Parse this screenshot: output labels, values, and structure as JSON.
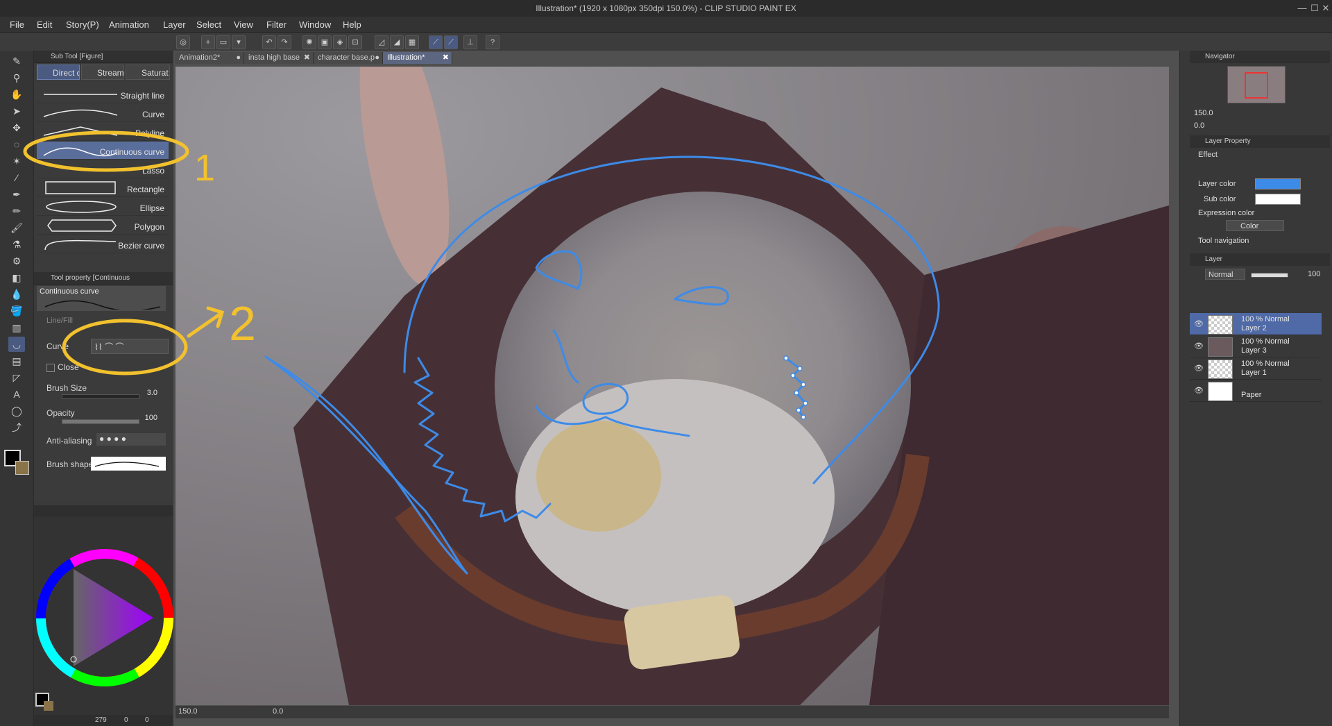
{
  "window": {
    "title": "Illustration* (1920 x 1080px 350dpi 150.0%)  - CLIP STUDIO PAINT EX",
    "minimize": "—",
    "maximize": "☐",
    "close": "✕"
  },
  "menu": [
    "File",
    "Edit",
    "Story(P)",
    "Animation",
    "Layer",
    "Select",
    "View",
    "Filter",
    "Window",
    "Help"
  ],
  "subtool_panel": {
    "header": "Sub Tool [Figure]",
    "tabs": [
      "Direct d",
      "Stream",
      "Saturat"
    ],
    "items": [
      {
        "label": "Straight line"
      },
      {
        "label": "Curve"
      },
      {
        "label": "Polyline"
      },
      {
        "label": "Continuous curve",
        "selected": true
      },
      {
        "label": "Lasso"
      },
      {
        "label": "Rectangle"
      },
      {
        "label": "Ellipse"
      },
      {
        "label": "Polygon"
      },
      {
        "label": "Bezier curve"
      }
    ]
  },
  "tool_property": {
    "header": "Tool property [Continuous",
    "preview_label": "Continuous curve",
    "line_fill": "Line/Fill",
    "curve_label": "Curve",
    "close_label": "Close",
    "brush_size_label": "Brush Size",
    "brush_size_value": "3.0",
    "opacity_label": "Opacity",
    "opacity_value": "100",
    "antialias_label": "Anti-aliasing",
    "brush_shape_label": "Brush shape"
  },
  "document_tabs": [
    {
      "label": "Animation2*",
      "close": "●"
    },
    {
      "label": "insta high base",
      "close": "✖"
    },
    {
      "label": "character base.p",
      "close": "●"
    },
    {
      "label": "Illustration*",
      "close": "✖",
      "active": true
    }
  ],
  "canvas_status": {
    "zoom": "150.0",
    "angle": "0.0"
  },
  "annotations": {
    "marker_1": "1",
    "marker_2": "2"
  },
  "navigator": {
    "header": "Navigator",
    "zoom": "150.0",
    "angle": "0.0"
  },
  "layer_property": {
    "header": "Layer Property",
    "effect": "Effect",
    "layer_color_label": "Layer color",
    "sub_color_label": "Sub color",
    "expression_color_label": "Expression color",
    "expression_color_value": "Color",
    "tool_navigation": "Tool navigation",
    "layer_color": "#3d8be8",
    "sub_color": "#ffffff"
  },
  "layer_panel": {
    "header": "Layer",
    "blend_mode": "Normal",
    "opacity": "100",
    "layers": [
      {
        "line1": "100 % Normal",
        "line2": "Layer 2",
        "selected": true
      },
      {
        "line1": "100 % Normal",
        "line2": "Layer 3"
      },
      {
        "line1": "100 % Normal",
        "line2": "Layer 1"
      },
      {
        "line1": "",
        "line2": "Paper"
      }
    ]
  },
  "color_panel": {
    "footer_left": "279",
    "footer_mid": "0",
    "footer_right": "0"
  }
}
